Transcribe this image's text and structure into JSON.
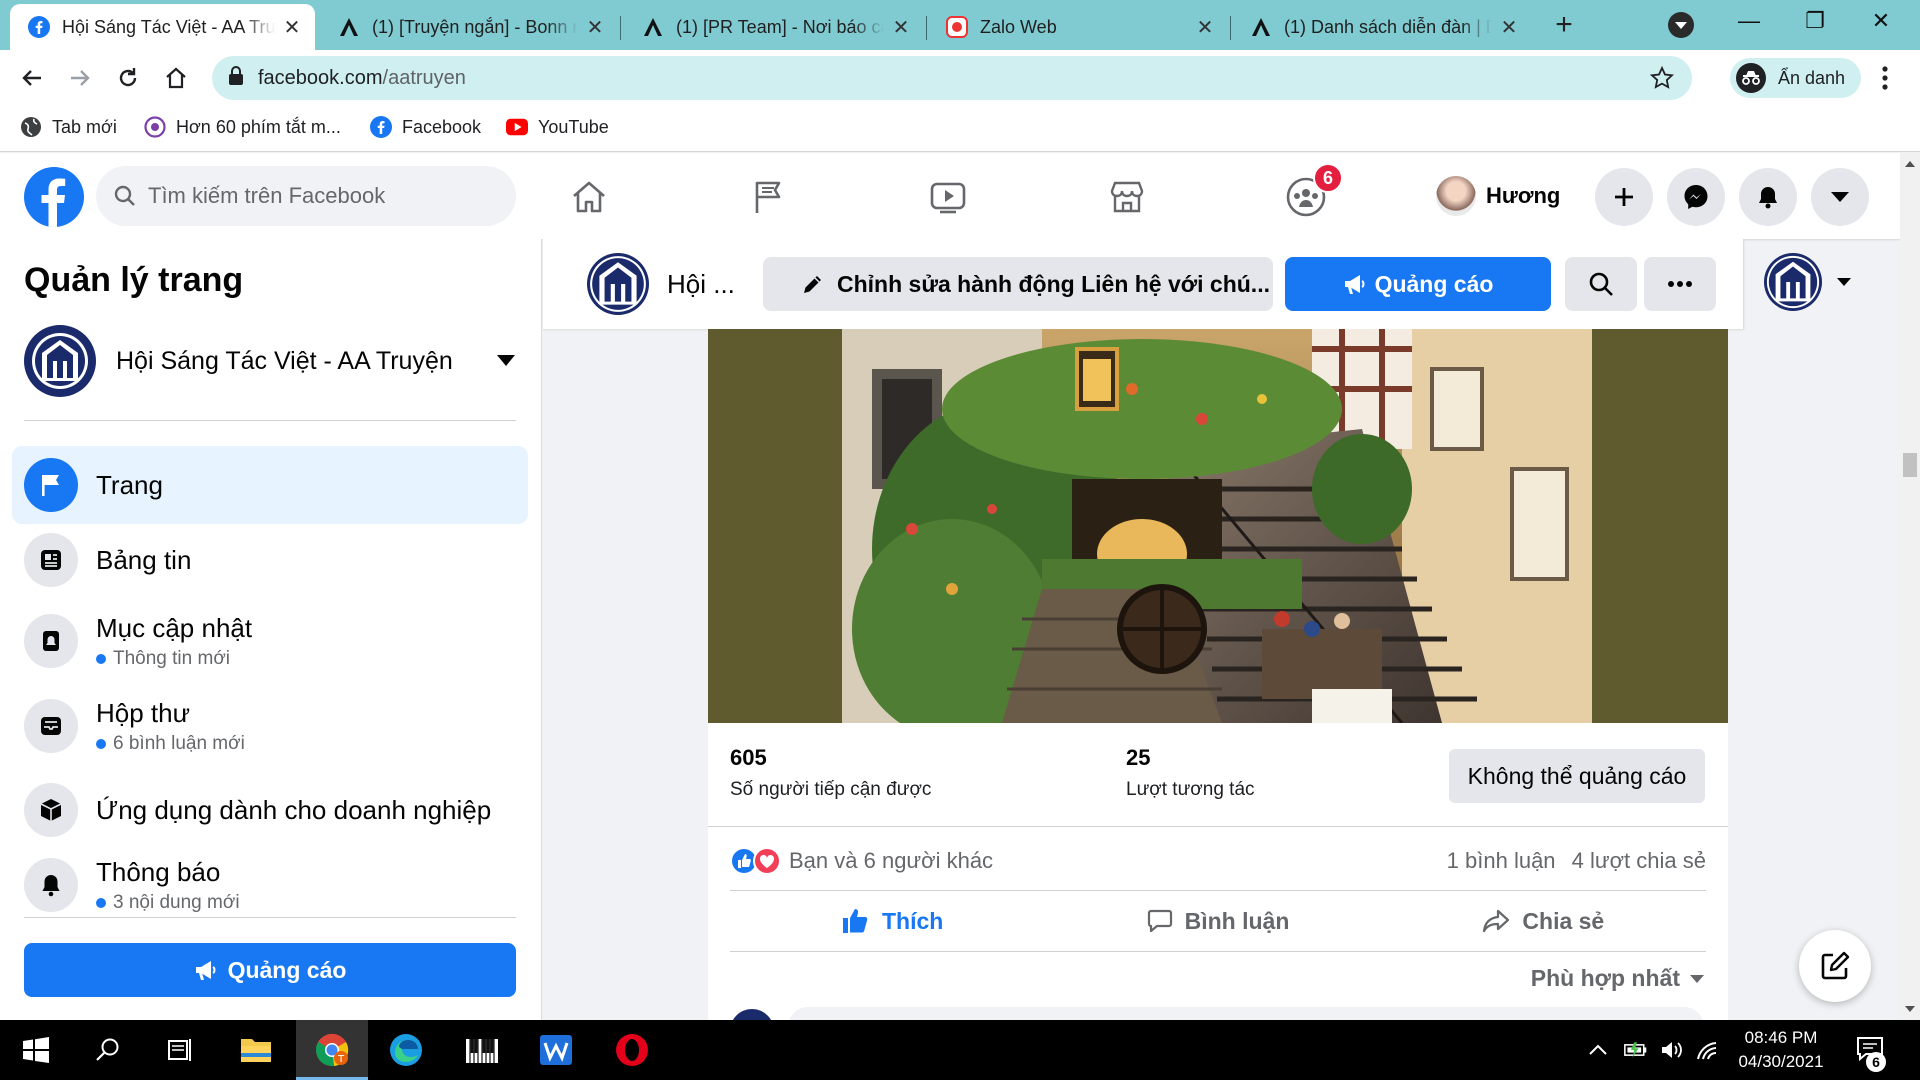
{
  "browser": {
    "tabs": [
      {
        "title": "Hội Sáng Tác Việt - AA Truyện",
        "icon": "facebook-icon",
        "active": true
      },
      {
        "title": "(1) [Truyện ngắn] - Bonn n",
        "icon": "aa-logo-icon",
        "active": false
      },
      {
        "title": "(1) [PR Team] - Nơi báo cáo",
        "icon": "aa-logo-icon",
        "active": false
      },
      {
        "title": "Zalo Web",
        "icon": "zalo-icon",
        "active": false
      },
      {
        "title": "(1) Danh sách diễn đàn | D",
        "icon": "aa-logo-icon",
        "active": false
      }
    ],
    "url_host": "facebook.com",
    "url_path": "/aatruyen",
    "incognito_label": "Ẩn danh",
    "bookmarks": [
      {
        "label": "Tab mới",
        "icon": "globe-icon"
      },
      {
        "label": "Hơn 60 phím tắt m...",
        "icon": "keyboard-shortcut-icon"
      },
      {
        "label": "Facebook",
        "icon": "facebook-icon"
      },
      {
        "label": "YouTube",
        "icon": "youtube-icon"
      }
    ]
  },
  "facebook": {
    "search_placeholder": "Tìm kiếm trên Facebook",
    "groups_badge": "6",
    "profile_name": "Hương",
    "manage": {
      "title": "Quản lý trang",
      "page_name": "Hội Sáng Tác Việt - AA Truyện",
      "items": [
        {
          "label": "Trang",
          "sub": "",
          "icon": "flag-icon"
        },
        {
          "label": "Bảng tin",
          "sub": "",
          "icon": "news-feed-icon"
        },
        {
          "label": "Mục cập nhật",
          "sub": "Thông tin mới",
          "icon": "updates-icon"
        },
        {
          "label": "Hộp thư",
          "sub": "6 bình luận mới",
          "icon": "inbox-icon"
        },
        {
          "label": "Ứng dụng dành cho doanh nghiệp",
          "sub": "",
          "icon": "cube-icon"
        },
        {
          "label": "Thông báo",
          "sub": "3 nội dung mới",
          "icon": "bell-icon"
        }
      ],
      "ads_button": "Quảng cáo"
    },
    "page_header": {
      "name": "Hội ...",
      "edit_action": "Chỉnh sửa hành động Liên hệ với chú...",
      "ads_button": "Quảng cáo"
    },
    "post": {
      "reach_value": "605",
      "reach_label": "Số người tiếp cận được",
      "engagement_value": "25",
      "engagement_label": "Lượt tương tác",
      "no_ads": "Không thể quảng cáo",
      "reactions_text": "Bạn và 6 người khác",
      "comments_count": "1 bình luận",
      "shares_count": "4 lượt chia sẻ",
      "like": "Thích",
      "comment": "Bình luận",
      "share": "Chia sẻ",
      "sort": "Phù hợp nhất"
    }
  },
  "taskbar": {
    "time": "08:46 PM",
    "date": "04/30/2021",
    "notifications": "6"
  }
}
